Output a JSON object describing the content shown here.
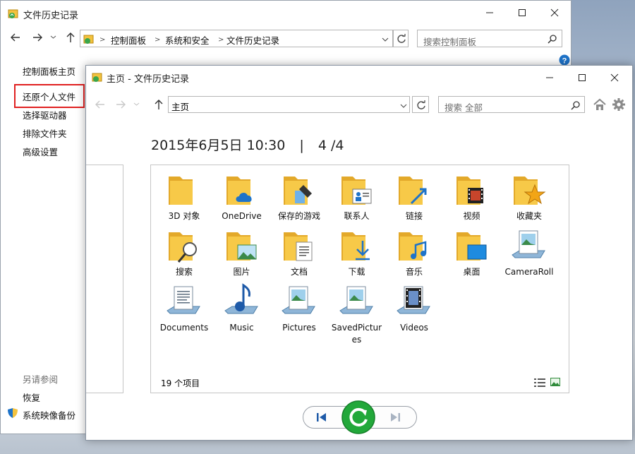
{
  "back_window": {
    "title": "文件历史记录",
    "breadcrumb": [
      "控制面板",
      "系统和安全",
      "文件历史记录"
    ],
    "search_placeholder": "搜索控制面板",
    "left_nav": {
      "home": "控制面板主页",
      "items": [
        "还原个人文件",
        "选择驱动器",
        "排除文件夹",
        "高级设置"
      ],
      "see_also_heading": "另请参阅",
      "see_also": [
        "恢复",
        "系统映像备份"
      ]
    }
  },
  "front_window": {
    "title": "主页 - 文件历史记录",
    "address": "主页",
    "search_placeholder": "搜索 全部",
    "date_time": "2015年6月5日 10:30",
    "separator": "|",
    "version": "4 /4",
    "items": [
      {
        "label": "3D 对象",
        "icon": "folder-plain-icon"
      },
      {
        "label": "OneDrive",
        "icon": "onedrive-folder-icon"
      },
      {
        "label": "保存的游戏",
        "icon": "saved-games-folder-icon"
      },
      {
        "label": "联系人",
        "icon": "contacts-folder-icon"
      },
      {
        "label": "链接",
        "icon": "links-folder-icon"
      },
      {
        "label": "视频",
        "icon": "videos-folder-icon"
      },
      {
        "label": "收藏夹",
        "icon": "favorites-folder-icon"
      },
      {
        "label": "搜索",
        "icon": "searches-folder-icon"
      },
      {
        "label": "图片",
        "icon": "pictures-folder-icon"
      },
      {
        "label": "文档",
        "icon": "documents-folder-icon"
      },
      {
        "label": "下载",
        "icon": "downloads-folder-icon"
      },
      {
        "label": "音乐",
        "icon": "music-folder-icon"
      },
      {
        "label": "桌面",
        "icon": "desktop-folder-icon"
      },
      {
        "label": "CameraRoll",
        "icon": "library-pictures-icon"
      },
      {
        "label": "Documents",
        "icon": "library-documents-icon"
      },
      {
        "label": "Music",
        "icon": "library-music-icon"
      },
      {
        "label": "Pictures",
        "icon": "library-pictures-icon"
      },
      {
        "label": "SavedPictures",
        "icon": "library-pictures-icon"
      },
      {
        "label": "Videos",
        "icon": "library-videos-icon"
      }
    ],
    "status": "19 个项目"
  },
  "colors": {
    "folder": "#f7c948",
    "folder_dark": "#e3a92a",
    "highlight_box": "#e02020",
    "restore_green": "#22a83a",
    "accent_blue": "#1e73c9"
  }
}
